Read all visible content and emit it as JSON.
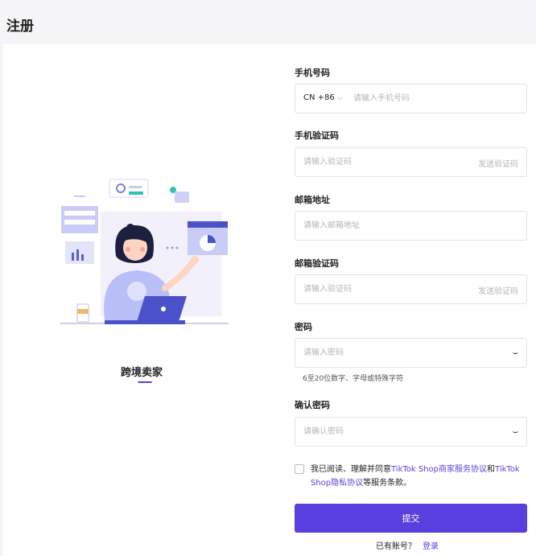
{
  "page": {
    "title": "注册"
  },
  "left": {
    "role_label": "跨境卖家"
  },
  "form": {
    "phone": {
      "label": "手机号码",
      "country_code": "CN +86",
      "placeholder": "请输入手机号码"
    },
    "phone_code": {
      "label": "手机验证码",
      "placeholder": "请输入验证码",
      "send_label": "发送验证码"
    },
    "email": {
      "label": "邮箱地址",
      "placeholder": "请输入邮箱地址"
    },
    "email_code": {
      "label": "邮箱验证码",
      "placeholder": "请输入验证码",
      "send_label": "发送验证码"
    },
    "password": {
      "label": "密码",
      "placeholder": "请输入密码",
      "hint": "6至20位数字、字母或特殊字符",
      "eye_icon": "eye-closed-icon"
    },
    "confirm_password": {
      "label": "确认密码",
      "placeholder": "请确认密码",
      "eye_icon": "eye-closed-icon"
    },
    "agreement": {
      "text_1": "我已阅读、理解并同意",
      "link_1": "TikTok Shop商家服务协议",
      "text_2": "和",
      "link_2": "TikTok Shop隐私协议",
      "text_3": "等服务条款。"
    },
    "submit_label": "提交",
    "have_account_text": "已有账号？",
    "login_label": "登录"
  },
  "colors": {
    "accent": "#5a3fe0",
    "link": "#5b3fd6"
  }
}
